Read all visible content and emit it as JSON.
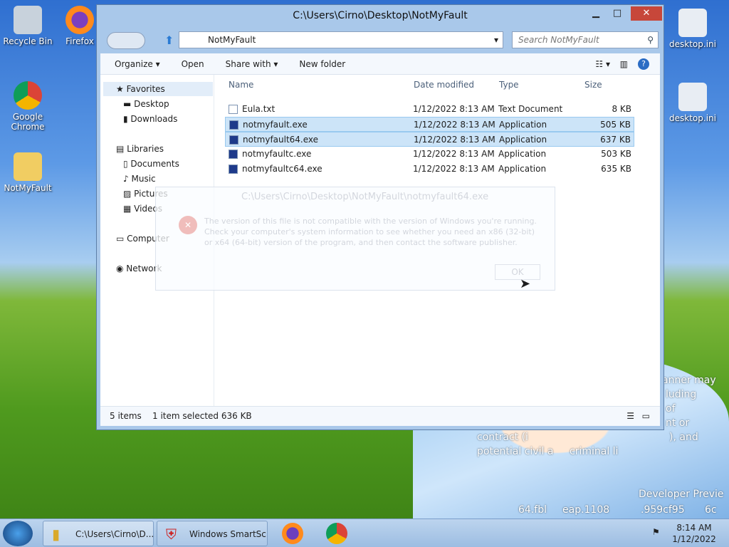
{
  "desktop": {
    "icons": [
      {
        "label": "Recycle Bin"
      },
      {
        "label": "Firefox"
      },
      {
        "label": "Google Chrome"
      },
      {
        "label": "NotMyFault"
      },
      {
        "label": "desktop.ini"
      },
      {
        "label": "desktop.ini"
      }
    ],
    "overlay_text": [
      "anner may",
      "luding",
      "of",
      "nt or",
      "contract (i",
      "), and",
      "potential civil a",
      "criminal li",
      "Developer Previe",
      "64.fbl",
      "eap.1108",
      ".959cf95",
      "6c"
    ]
  },
  "window": {
    "title": "C:\\Users\\Cirno\\Desktop\\NotMyFault",
    "address": "NotMyFault",
    "search_placeholder": "Search NotMyFault",
    "toolbar": {
      "organize": "Organize",
      "open": "Open",
      "share_with": "Share with",
      "new_folder": "New folder"
    },
    "nav": {
      "favorites": "Favorites",
      "desktop": "Desktop",
      "downloads": "Downloads",
      "libraries": "Libraries",
      "documents": "Documents",
      "music": "Music",
      "pictures": "Pictures",
      "videos": "Videos",
      "computer": "Computer",
      "network": "Network"
    },
    "columns": {
      "name": "Name",
      "date": "Date modified",
      "type": "Type",
      "size": "Size"
    },
    "files": [
      {
        "name": "Eula.txt",
        "date": "1/12/2022 8:13 AM",
        "type": "Text Document",
        "size": "8 KB"
      },
      {
        "name": "notmyfault.exe",
        "date": "1/12/2022 8:13 AM",
        "type": "Application",
        "size": "505 KB"
      },
      {
        "name": "notmyfault64.exe",
        "date": "1/12/2022 8:13 AM",
        "type": "Application",
        "size": "637 KB"
      },
      {
        "name": "notmyfaultc.exe",
        "date": "1/12/2022 8:13 AM",
        "type": "Application",
        "size": "503 KB"
      },
      {
        "name": "notmyfaultc64.exe",
        "date": "1/12/2022 8:13 AM",
        "type": "Application",
        "size": "635 KB"
      }
    ],
    "status": {
      "items": "5 items",
      "selected": "1 item selected  636 KB"
    }
  },
  "dialog": {
    "title": "C:\\Users\\Cirno\\Desktop\\NotMyFault\\notmyfault64.exe",
    "message": "The version of this file is not compatible with the version of Windows you're running. Check your computer's system information to see whether you need an x86 (32-bit) or x64 (64-bit) version of the program, and then contact the software publisher.",
    "ok": "OK"
  },
  "taskbar": {
    "explorer": "C:\\Users\\Cirno\\D...",
    "smartscreen": "Windows SmartSc...",
    "time": "8:14 AM",
    "date": "1/12/2022"
  }
}
